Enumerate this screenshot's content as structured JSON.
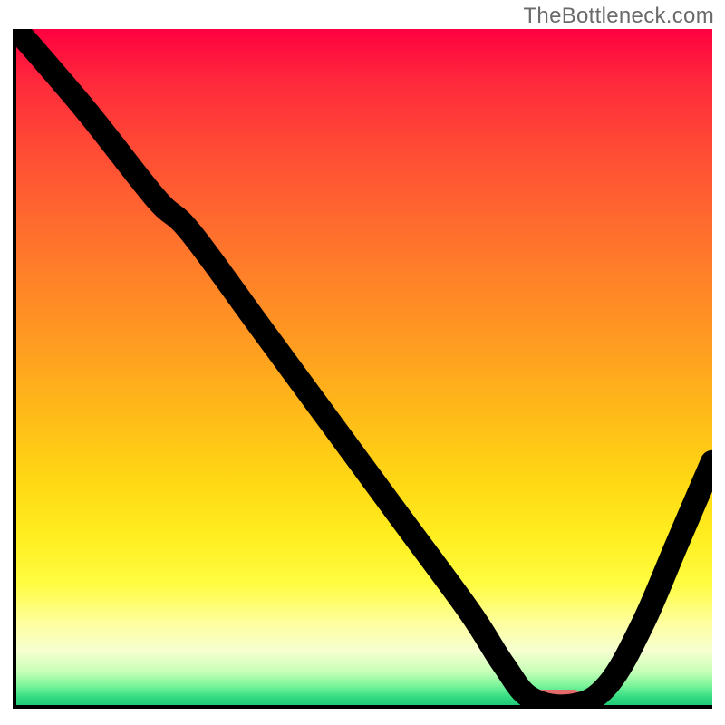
{
  "watermark": "TheBottleneck.com",
  "colors": {
    "marker": "#e46a6c",
    "curve": "#000000",
    "axis": "#000000"
  },
  "chart_data": {
    "type": "line",
    "title": "",
    "xlabel": "",
    "ylabel": "",
    "xlim": [
      0,
      100
    ],
    "ylim": [
      0,
      100
    ],
    "x": [
      0,
      10,
      20,
      25,
      35,
      45,
      55,
      65,
      70,
      74,
      80,
      85,
      90,
      95,
      100
    ],
    "values": [
      100,
      88,
      75,
      70,
      56,
      42,
      28,
      14,
      6,
      1,
      0,
      3,
      12,
      24,
      36
    ],
    "optimal_range_x": [
      73,
      81
    ],
    "gradient_bands": [
      {
        "stop": 0.0,
        "color": "#ff0040"
      },
      {
        "stop": 0.82,
        "color": "#fffc40"
      },
      {
        "stop": 0.95,
        "color": "#c8ffb8"
      },
      {
        "stop": 1.0,
        "color": "#20cc78"
      }
    ]
  }
}
